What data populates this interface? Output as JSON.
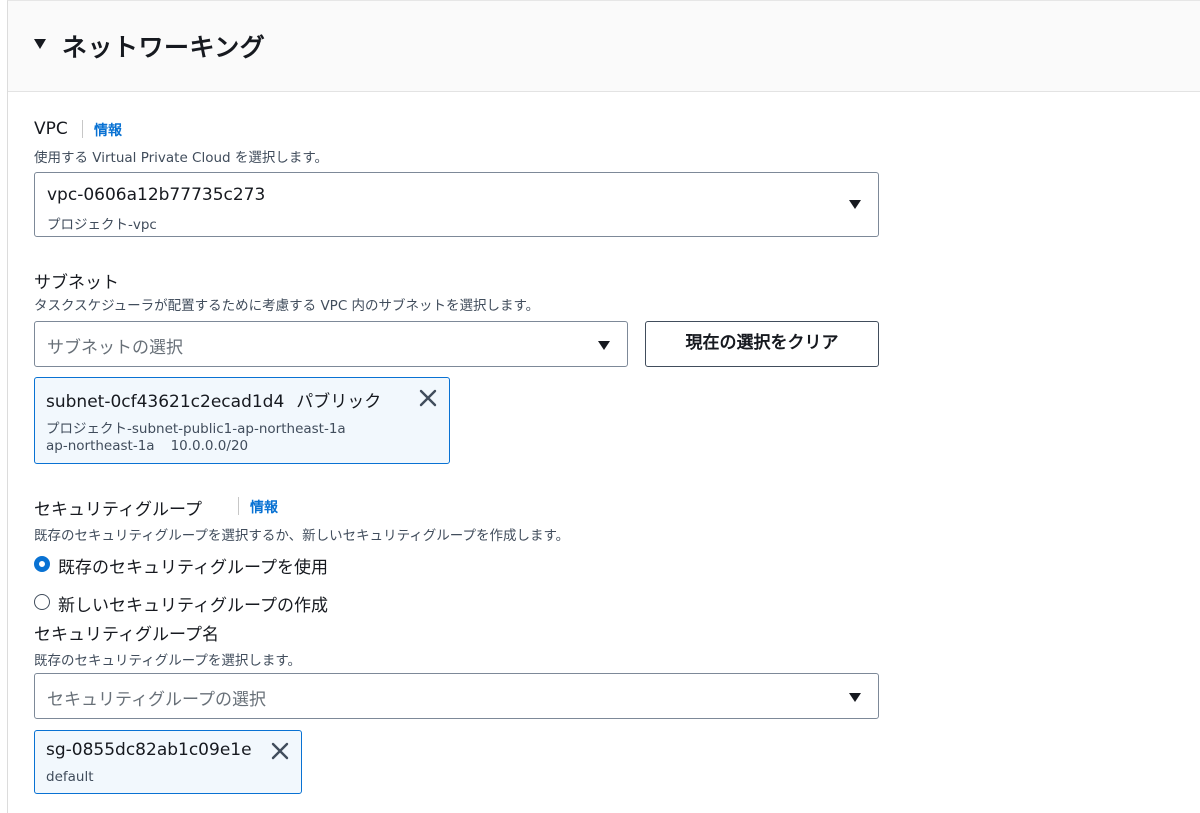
{
  "section": {
    "title": "ネットワーキング"
  },
  "vpc": {
    "label": "VPC",
    "info": "情報",
    "description": "使用する Virtual Private Cloud を選択します。",
    "selected_id": "vpc-0606a12b77735c273",
    "selected_name": "プロジェクト-vpc"
  },
  "subnet": {
    "label": "サブネット",
    "description": "タスクスケジューラが配置するために考慮する VPC 内のサブネットを選択します。",
    "placeholder": "サブネットの選択",
    "clear_button": "現在の選択をクリア",
    "token": {
      "id": "subnet-0cf43621c2ecad1d4",
      "type": "パブリック",
      "name": "プロジェクト-subnet-public1-ap-northeast-1a",
      "az": "ap-northeast-1a",
      "cidr": "10.0.0.0/20"
    }
  },
  "security_group": {
    "label": "セキュリティグループ",
    "info": "情報",
    "description": "既存のセキュリティグループを選択するか、新しいセキュリティグループを作成します。",
    "options": [
      {
        "label": "既存のセキュリティグループを使用",
        "selected": true
      },
      {
        "label": "新しいセキュリティグループの作成",
        "selected": false
      }
    ],
    "name_label": "セキュリティグループ名",
    "name_description": "既存のセキュリティグループを選択します。",
    "placeholder": "セキュリティグループの選択",
    "token": {
      "id": "sg-0855dc82ab1c09e1e",
      "name": "default"
    }
  },
  "colors": {
    "accent": "#0972d3",
    "token_bg": "#f2f8fd",
    "header_bg": "#fafafa"
  },
  "icons": {
    "expand": "caret-down-icon",
    "dropdown": "triangle-down-icon",
    "remove": "close-icon",
    "radio_selected": "radio-checked-icon",
    "radio_unselected": "radio-unchecked-icon"
  }
}
